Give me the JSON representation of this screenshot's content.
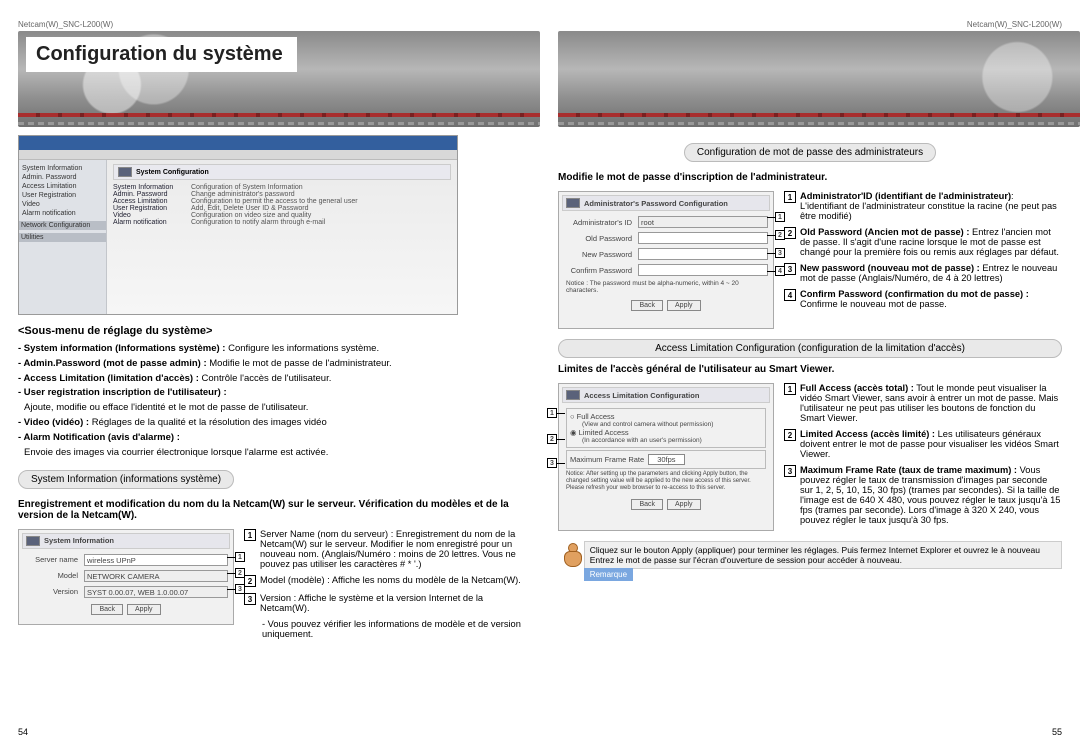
{
  "header": {
    "left": "Netcam(W)_SNC-L200(W)",
    "right": "Netcam(W)_SNC-L200(W)"
  },
  "banner": {
    "title": "Configuration du système"
  },
  "pagenum": {
    "left": "54",
    "right": "55"
  },
  "mainshot": {
    "panel_title": "System Configuration",
    "nav_items": [
      "System Information",
      "Admin. Password",
      "Access Limitation",
      "User Registration",
      "Video",
      "Alarm notification"
    ],
    "nav_hdrs": [
      "Network Configuration",
      "Utilities"
    ],
    "rows": [
      {
        "k": "System Information",
        "v": "Configuration of System Information"
      },
      {
        "k": "Admin. Password",
        "v": "Change administrator's password"
      },
      {
        "k": "Access Limitation",
        "v": "Configuration to permit the access to the general user"
      },
      {
        "k": "User Registration",
        "v": "Add, Edit, Delete User ID & Password"
      },
      {
        "k": "Video",
        "v": "Configuration on video size and quality"
      },
      {
        "k": "Alarm notification",
        "v": "Configuration to notify alarm through e-mail"
      }
    ]
  },
  "submenu": {
    "title": "<Sous-menu de réglage du système>",
    "items": [
      {
        "bold": "- System information (Informations système) :",
        "rest": " Configure les informations système."
      },
      {
        "bold": "- Admin.Password (mot de passe admin) :",
        "rest": " Modifie le mot de passe de l'administrateur."
      },
      {
        "bold": "- Access Limitation (limitation d'accès) :",
        "rest": " Contrôle l'accès de l'utilisateur."
      },
      {
        "bold": "- User registration inscription de l'utilisateur) :",
        "rest": ""
      },
      {
        "bold": "",
        "rest": "Ajoute, modifie ou efface l'identité et le mot de passe de l'utilisateur."
      },
      {
        "bold": "- Video (vidéo) :",
        "rest": " Réglages de la qualité et la résolution des images vidéo"
      },
      {
        "bold": "- Alarm Notification (avis d'alarme) :",
        "rest": ""
      },
      {
        "bold": "",
        "rest": "Envoie des images via courrier électronique lorsque l'alarme est activée."
      }
    ]
  },
  "sysinfo": {
    "pill": "System Information (informations système)",
    "boldline": "Enregistrement et modification du nom du la Netcam(W) sur le serveur. Vérification du modèles et de la version de la Netcam(W).",
    "ss": {
      "title": "System Information",
      "fields": [
        {
          "label": "Server name",
          "value": "wireless UPnP"
        },
        {
          "label": "Model",
          "value": "NETWORK CAMERA"
        },
        {
          "label": "Version",
          "value": "SYST 0.00.07, WEB 1.0.00.07"
        }
      ],
      "btns": [
        "Back",
        "Apply"
      ]
    },
    "numlist": [
      {
        "n": "1",
        "t": "Server Name (nom du serveur) : Enregistrement du nom de la Netcam(W) sur le serveur. Modifier le nom enregistré pour un nouveau nom. (Anglais/Numéro : moins de 20 lettres. Vous ne pouvez pas utiliser les caractères # * '.)"
      },
      {
        "n": "2",
        "t": "Model (modèle) : Affiche les noms du modèle de la Netcam(W)."
      },
      {
        "n": "3",
        "t": "Version : Affiche le système et la version Internet de la Netcam(W)."
      }
    ],
    "tail": "- Vous pouvez vérifier les informations de modèle et de version uniquement."
  },
  "admin": {
    "pill": "Configuration de mot de passe des administrateurs",
    "boldline": "Modifie le mot de passe d'inscription de l'administrateur.",
    "ss": {
      "title": "Administrator's Password Configuration",
      "fields": [
        {
          "label": "Administrator's ID",
          "value": "root"
        },
        {
          "label": "Old Password",
          "value": ""
        },
        {
          "label": "New Password",
          "value": ""
        },
        {
          "label": "Confirm Password",
          "value": ""
        }
      ],
      "notice": "Notice : The password must be alpha-numeric, within 4 ~ 20 characters.",
      "btns": [
        "Back",
        "Apply"
      ]
    },
    "numlist": [
      {
        "n": "1",
        "b": "Administrator'ID (identifiant de l'administrateur)",
        "t": ": L'identifiant de l'administrateur constitue la racine (ne peut pas être modifié)"
      },
      {
        "n": "2",
        "b": "Old Password (Ancien mot de passe) :",
        "t": " Entrez l'ancien mot de passe. Il s'agit d'une racine lorsque le mot de passe est changé pour la première fois ou remis aux réglages par défaut."
      },
      {
        "n": "3",
        "b": "New password (nouveau mot de passe) :",
        "t": " Entrez le nouveau mot de passe (Anglais/Numéro, de 4 à 20 lettres)"
      },
      {
        "n": "4",
        "b": "Confirm Password (confirmation du mot de passe) :",
        "t": " Confirme le nouveau mot de passe."
      }
    ]
  },
  "access": {
    "pill": "Access Limitation Configuration (configuration de la limitation d'accès)",
    "boldline": "Limites de l'accès général de l'utilisateur au Smart Viewer.",
    "ss": {
      "title": "Access Limitation Configuration",
      "opt1": "Full Access",
      "opt1sub": "(View and control camera without permission)",
      "opt2": "Limited Access",
      "opt2sub": "(In accordance with an user's permission)",
      "ratelabel": "Maximum Frame Rate",
      "rateval": "30fps",
      "notice": "Notice: After setting up the parameters and clicking Apply button, the changed setting value will be applied to the new access of this server. Please refresh your web browser to re-access to this server.",
      "btns": [
        "Back",
        "Apply"
      ]
    },
    "numlist": [
      {
        "n": "1",
        "b": "Full Access (accès total) :",
        "t": " Tout le monde peut visualiser la vidéo Smart Viewer, sans avoir à entrer un mot de passe. Mais l'utilisateur ne peut pas utiliser les boutons de fonction du Smart Viewer."
      },
      {
        "n": "2",
        "b": "Limited Access (accès limité) :",
        "t": " Les utilisateurs généraux doivent entrer le mot de passe pour visualiser les vidéos Smart Viewer."
      },
      {
        "n": "3",
        "b": "Maximum Frame Rate (taux de trame maximum) :",
        "t": " Vous pouvez régler le taux de transmission d'images par seconde sur 1, 2, 5, 10, 15, 30 fps) (trames par secondes). Si la taille de l'image est de 640 X 480, vous pouvez régler le taux jusqu'à 15 fps (trames par seconde). Lors d'image à  320 X 240, vous pouvez régler le taux jusqu'à 30 fps."
      }
    ]
  },
  "remark": {
    "label": "Remarque",
    "text": "Cliquez sur le bouton Apply (appliquer) pour terminer les réglages. Puis fermez Internet Explorer et ouvrez le à nouveau Entrez le mot de passe sur l'écran d'ouverture de session pour accéder à nouveau."
  }
}
